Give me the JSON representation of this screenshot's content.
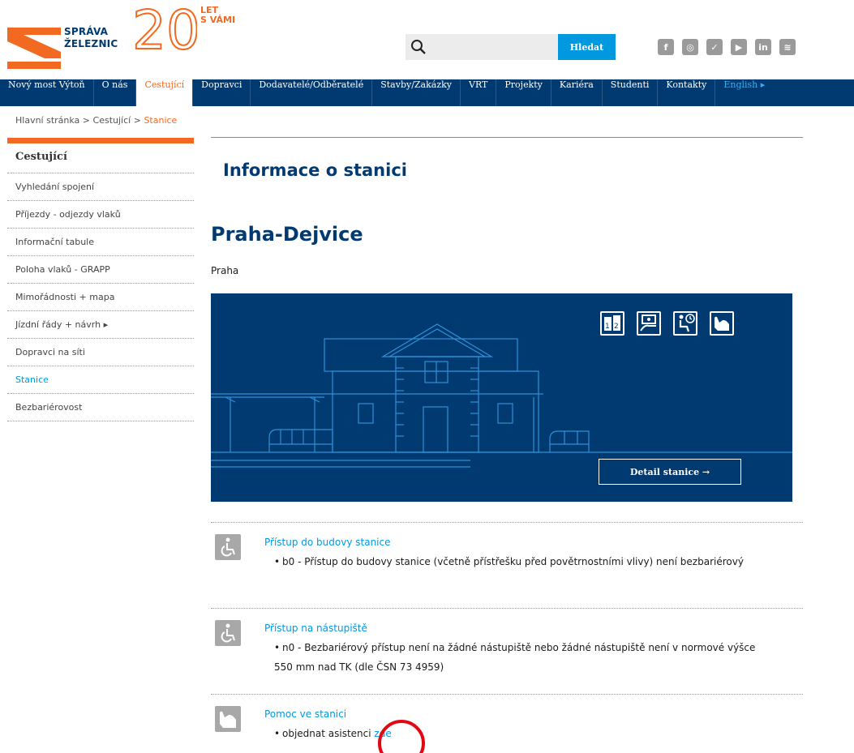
{
  "brand": {
    "line1": "SPRÁVA",
    "line2": "ŽELEZNIC",
    "anniversary_number": "20",
    "anniversary_line1": "LET",
    "anniversary_line2": "S VÁMI",
    "color_orange": "#f26a21",
    "color_navy": "#003a70"
  },
  "search": {
    "placeholder": "",
    "value": "",
    "button_label": "Hledat"
  },
  "social": [
    {
      "name": "facebook-icon",
      "glyph": "f"
    },
    {
      "name": "instagram-icon",
      "glyph": "◎"
    },
    {
      "name": "twitter-icon",
      "glyph": "✓"
    },
    {
      "name": "youtube-icon",
      "glyph": "▶"
    },
    {
      "name": "linkedin-icon",
      "glyph": "in"
    },
    {
      "name": "spotify-icon",
      "glyph": "≋"
    }
  ],
  "nav": {
    "items": [
      {
        "label": "Nový most Výtoň"
      },
      {
        "label": "O nás"
      },
      {
        "label": "Cestující"
      },
      {
        "label": "Dopravci"
      },
      {
        "label": "Dodavatelé/Odběratelé"
      },
      {
        "label": "Stavby/Zakázky"
      },
      {
        "label": "VRT"
      },
      {
        "label": "Projekty"
      },
      {
        "label": "Kariéra"
      },
      {
        "label": "Studenti"
      },
      {
        "label": "Kontakty"
      },
      {
        "label": "English ▸"
      }
    ]
  },
  "breadcrumb": {
    "home": "Hlavní stránka",
    "sep1": " > ",
    "parent": "Cestující",
    "sep2": " > ",
    "current": "Stanice"
  },
  "sidebar": {
    "title": "Cestující",
    "items": [
      {
        "label": "Vyhledání spojení"
      },
      {
        "label": "Příjezdy - odjezdy vlaků"
      },
      {
        "label": "Informační tabule"
      },
      {
        "label": "Poloha vlaků - GRAPP"
      },
      {
        "label": "Mimořádnosti + mapa"
      },
      {
        "label": "Jízdní řády + návrh ▸"
      },
      {
        "label": "Dopravci na síti"
      },
      {
        "label": "Stanice"
      },
      {
        "label": "Bezbariérovost"
      }
    ]
  },
  "main": {
    "page_title": "Informace o stanici",
    "station_name": "Praha-Dejvice",
    "station_city": "Praha",
    "detail_button": "Detail stanice →"
  },
  "accessibility": [
    {
      "title": "Přístup do budovy stanice",
      "text": "b0 - Přístup do budovy stanice (včetně přístřešku před povětrnostními vlivy) není bezbariérový"
    },
    {
      "title": "Přístup na nástupiště",
      "text": "n0 - Bezbariérový přístup není na žádné nástupiště nebo žádné nástupiště není v normové výšce 550 mm nad TK (dle ČSN 73 4959)"
    },
    {
      "title": "Pomoc ve stanici",
      "text": "objednat asistenci",
      "link": "zde"
    }
  ]
}
